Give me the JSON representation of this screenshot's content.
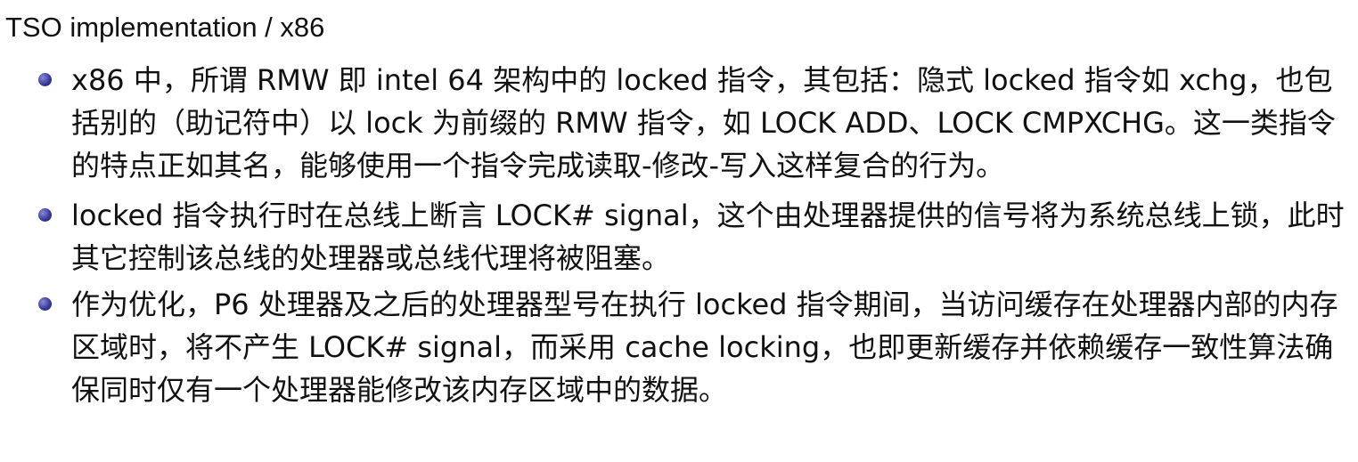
{
  "title": "TSO implementation / x86",
  "bullets": [
    {
      "text": "x86 中，所谓 RMW 即 intel 64 架构中的 locked 指令，其包括：隐式 locked 指令如 xchg，也包括别的（助记符中）以 lock 为前缀的 RMW 指令，如 LOCK ADD、LOCK CMPXCHG。这一类指令的特点正如其名，能够使用一个指令完成读取-修改-写入这样复合的行为。"
    },
    {
      "text": "locked 指令执行时在总线上断言 LOCK# signal，这个由处理器提供的信号将为系统总线上锁，此时其它控制该总线的处理器或总线代理将被阻塞。"
    },
    {
      "text": "作为优化，P6 处理器及之后的处理器型号在执行 locked 指令期间，当访问缓存在处理器内部的内存区域时，将不产生 LOCK# signal，而采用 cache locking，也即更新缓存并依赖缓存一致性算法确保同时仅有一个处理器能修改该内存区域中的数据。"
    }
  ]
}
